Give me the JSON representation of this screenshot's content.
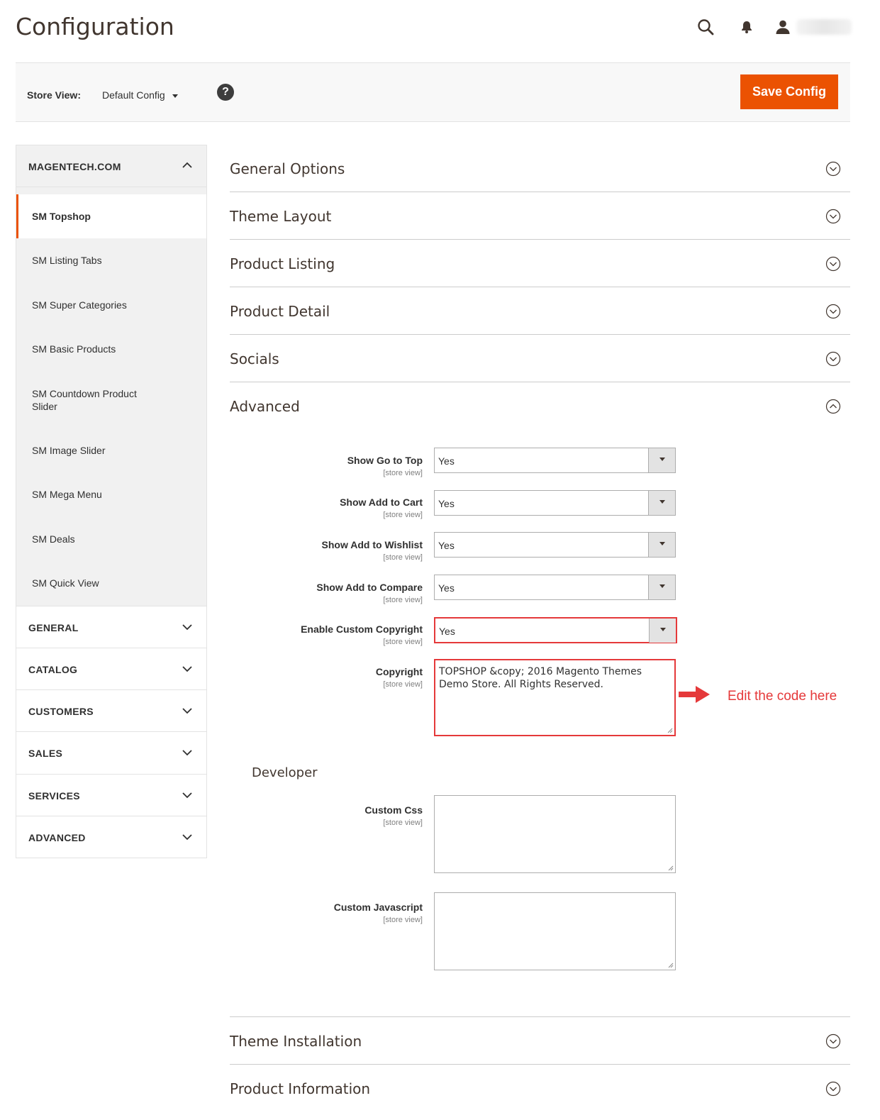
{
  "header": {
    "title": "Configuration",
    "search_icon": "search-icon",
    "bell_icon": "bell-icon",
    "user_icon": "user-icon"
  },
  "store_bar": {
    "label": "Store View:",
    "selected": "Default Config",
    "help": "?",
    "save_label": "Save Config"
  },
  "sidebar": {
    "tab_label": "MAGENTECH.COM",
    "items": [
      {
        "label": "SM Topshop",
        "active": true
      },
      {
        "label": "SM Listing Tabs"
      },
      {
        "label": "SM Super Categories"
      },
      {
        "label": "SM Basic Products"
      },
      {
        "label": "SM Countdown Product Slider"
      },
      {
        "label": "SM Image Slider"
      },
      {
        "label": "SM Mega Menu"
      },
      {
        "label": "SM Deals"
      },
      {
        "label": "SM Quick View"
      }
    ],
    "groups": [
      "GENERAL",
      "CATALOG",
      "CUSTOMERS",
      "SALES",
      "SERVICES",
      "ADVANCED"
    ]
  },
  "sections": {
    "general": "General Options",
    "layout": "Theme Layout",
    "listing": "Product Listing",
    "detail": "Product Detail",
    "socials": "Socials",
    "advanced": "Advanced",
    "installation": "Theme Installation",
    "information": "Product Information"
  },
  "advanced": {
    "scope": "[store view]",
    "fields": [
      {
        "label": "Show Go to Top",
        "value": "Yes"
      },
      {
        "label": "Show Add to Cart",
        "value": "Yes"
      },
      {
        "label": "Show Add to Wishlist",
        "value": "Yes"
      },
      {
        "label": "Show Add to Compare",
        "value": "Yes"
      },
      {
        "label": "Enable Custom Copyright",
        "value": "Yes"
      }
    ],
    "copyright_label": "Copyright",
    "copyright_value": "TOPSHOP  &copy;  2016 Magento Themes Demo Store. All Rights Reserved.",
    "developer_title": "Developer",
    "custom_css_label": "Custom Css",
    "custom_css_value": "",
    "custom_js_label": "Custom Javascript",
    "custom_js_value": ""
  },
  "annotation": {
    "text": "Edit the code here"
  },
  "colors": {
    "accent": "#eb5202",
    "highlight": "#e5393a"
  }
}
